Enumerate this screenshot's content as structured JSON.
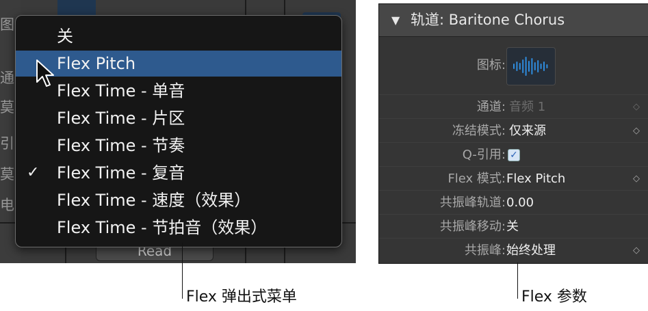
{
  "flex_popup_menu": {
    "items": [
      {
        "label": "关",
        "checked": false,
        "selected": false
      },
      {
        "label": "Flex Pitch",
        "checked": false,
        "selected": true
      },
      {
        "label": "Flex Time - 单音",
        "checked": false,
        "selected": false
      },
      {
        "label": "Flex Time - 片区",
        "checked": false,
        "selected": false
      },
      {
        "label": "Flex Time - 节奏",
        "checked": false,
        "selected": false
      },
      {
        "label": "Flex Time - 复音",
        "checked": true,
        "selected": false
      },
      {
        "label": "Flex Time - 速度（效果）",
        "checked": false,
        "selected": false
      },
      {
        "label": "Flex Time - 节拍音（效果）",
        "checked": false,
        "selected": false
      }
    ],
    "checkmark": "✓",
    "highlight_color": "#2e5a8e"
  },
  "left_background": {
    "partial_labels": [
      "图",
      "通",
      "莫",
      "引",
      "莫",
      "电"
    ],
    "read_button_label": "Read"
  },
  "inspector": {
    "header_triangle": "▼",
    "title": "轨道: Baritone Chorus",
    "rows": {
      "icon": {
        "label": "图标:"
      },
      "channel": {
        "label": "通道:",
        "value": "音频 1",
        "enabled": false
      },
      "freeze_mode": {
        "label": "冻结模式:",
        "value": "仅来源"
      },
      "q_reference": {
        "label": "Q-引用:",
        "checked": true
      },
      "flex_mode": {
        "label": "Flex 模式:",
        "value": "Flex Pitch"
      },
      "formant_track": {
        "label": "共振峰轨道:",
        "value": "0.00"
      },
      "formant_shift": {
        "label": "共振峰移动:",
        "value": "关"
      },
      "formant": {
        "label": "共振峰:",
        "value": "始终处理"
      }
    },
    "stepper_glyph": "⌃⌄",
    "waveform_color": "#2f8de0"
  },
  "captions": {
    "left": "Flex 弹出式菜单",
    "right": "Flex 参数"
  }
}
